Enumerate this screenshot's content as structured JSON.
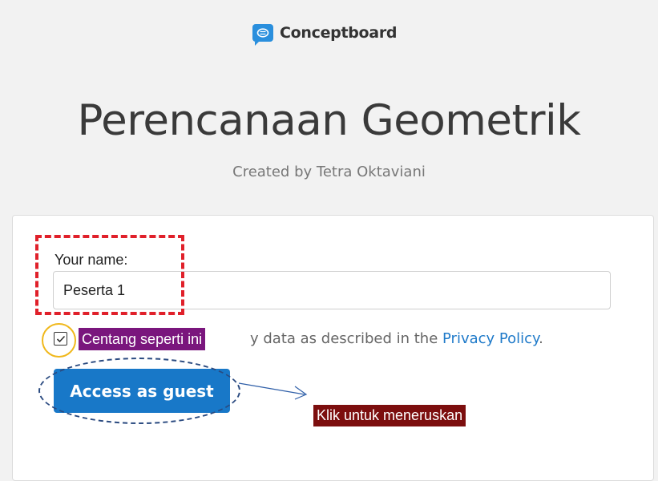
{
  "brand": {
    "name": "Conceptboard",
    "logo_icon": "conceptboard-logo-icon",
    "color": "#2a8fdd"
  },
  "board": {
    "title": "Perencanaan Geometrik",
    "subtitle": "Created by Tetra Oktaviani"
  },
  "form": {
    "name_label": "Your name:",
    "name_value": "Peserta 1",
    "consent_tail": "y data as described in the ",
    "privacy_link": "Privacy Policy",
    "consent_end": ".",
    "checkbox_checked": true,
    "submit_label": "Access as guest",
    "accent": "#1878c8"
  },
  "annotations": {
    "checkbox_note": "Centang seperti ini",
    "button_note": "Klik untuk meneruskan",
    "checkbox_note_bg": "#7a167d",
    "button_note_bg": "#7c0e0e",
    "highlight_colors": {
      "name_box": "#e0202a",
      "checkbox_circle": "#f0b81c",
      "button_ellipse": "#2a4a80"
    }
  }
}
